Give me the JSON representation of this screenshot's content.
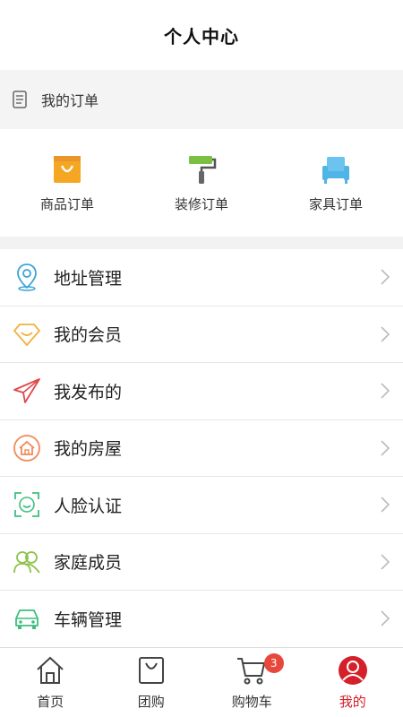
{
  "header": {
    "title": "个人中心"
  },
  "orders": {
    "section_label": "我的订单",
    "types": [
      {
        "label": "商品订单",
        "icon": "shopping-bag-icon",
        "color": "#f5a623"
      },
      {
        "label": "装修订单",
        "icon": "paint-roller-icon",
        "color": "#7ac143"
      },
      {
        "label": "家具订单",
        "icon": "sofa-icon",
        "color": "#4fb4e8"
      }
    ]
  },
  "menu": {
    "items": [
      {
        "label": "地址管理",
        "icon": "location-pin-icon",
        "color": "#3aa3d9"
      },
      {
        "label": "我的会员",
        "icon": "diamond-icon",
        "color": "#f0b23c"
      },
      {
        "label": "我发布的",
        "icon": "paper-plane-icon",
        "color": "#e04848"
      },
      {
        "label": "我的房屋",
        "icon": "house-icon",
        "color": "#f08a5a"
      },
      {
        "label": "人脸认证",
        "icon": "face-scan-icon",
        "color": "#3fbf7f"
      },
      {
        "label": "家庭成员",
        "icon": "family-icon",
        "color": "#8bc34a"
      },
      {
        "label": "车辆管理",
        "icon": "car-icon",
        "color": "#3fbf7f"
      }
    ]
  },
  "tabbar": {
    "tabs": [
      {
        "label": "首页",
        "icon": "home-icon"
      },
      {
        "label": "团购",
        "icon": "bag-icon"
      },
      {
        "label": "购物车",
        "icon": "cart-icon",
        "badge": "3"
      },
      {
        "label": "我的",
        "icon": "user-icon",
        "active": true
      }
    ],
    "active_color": "#d4202a",
    "badge_color": "#e8473c"
  }
}
